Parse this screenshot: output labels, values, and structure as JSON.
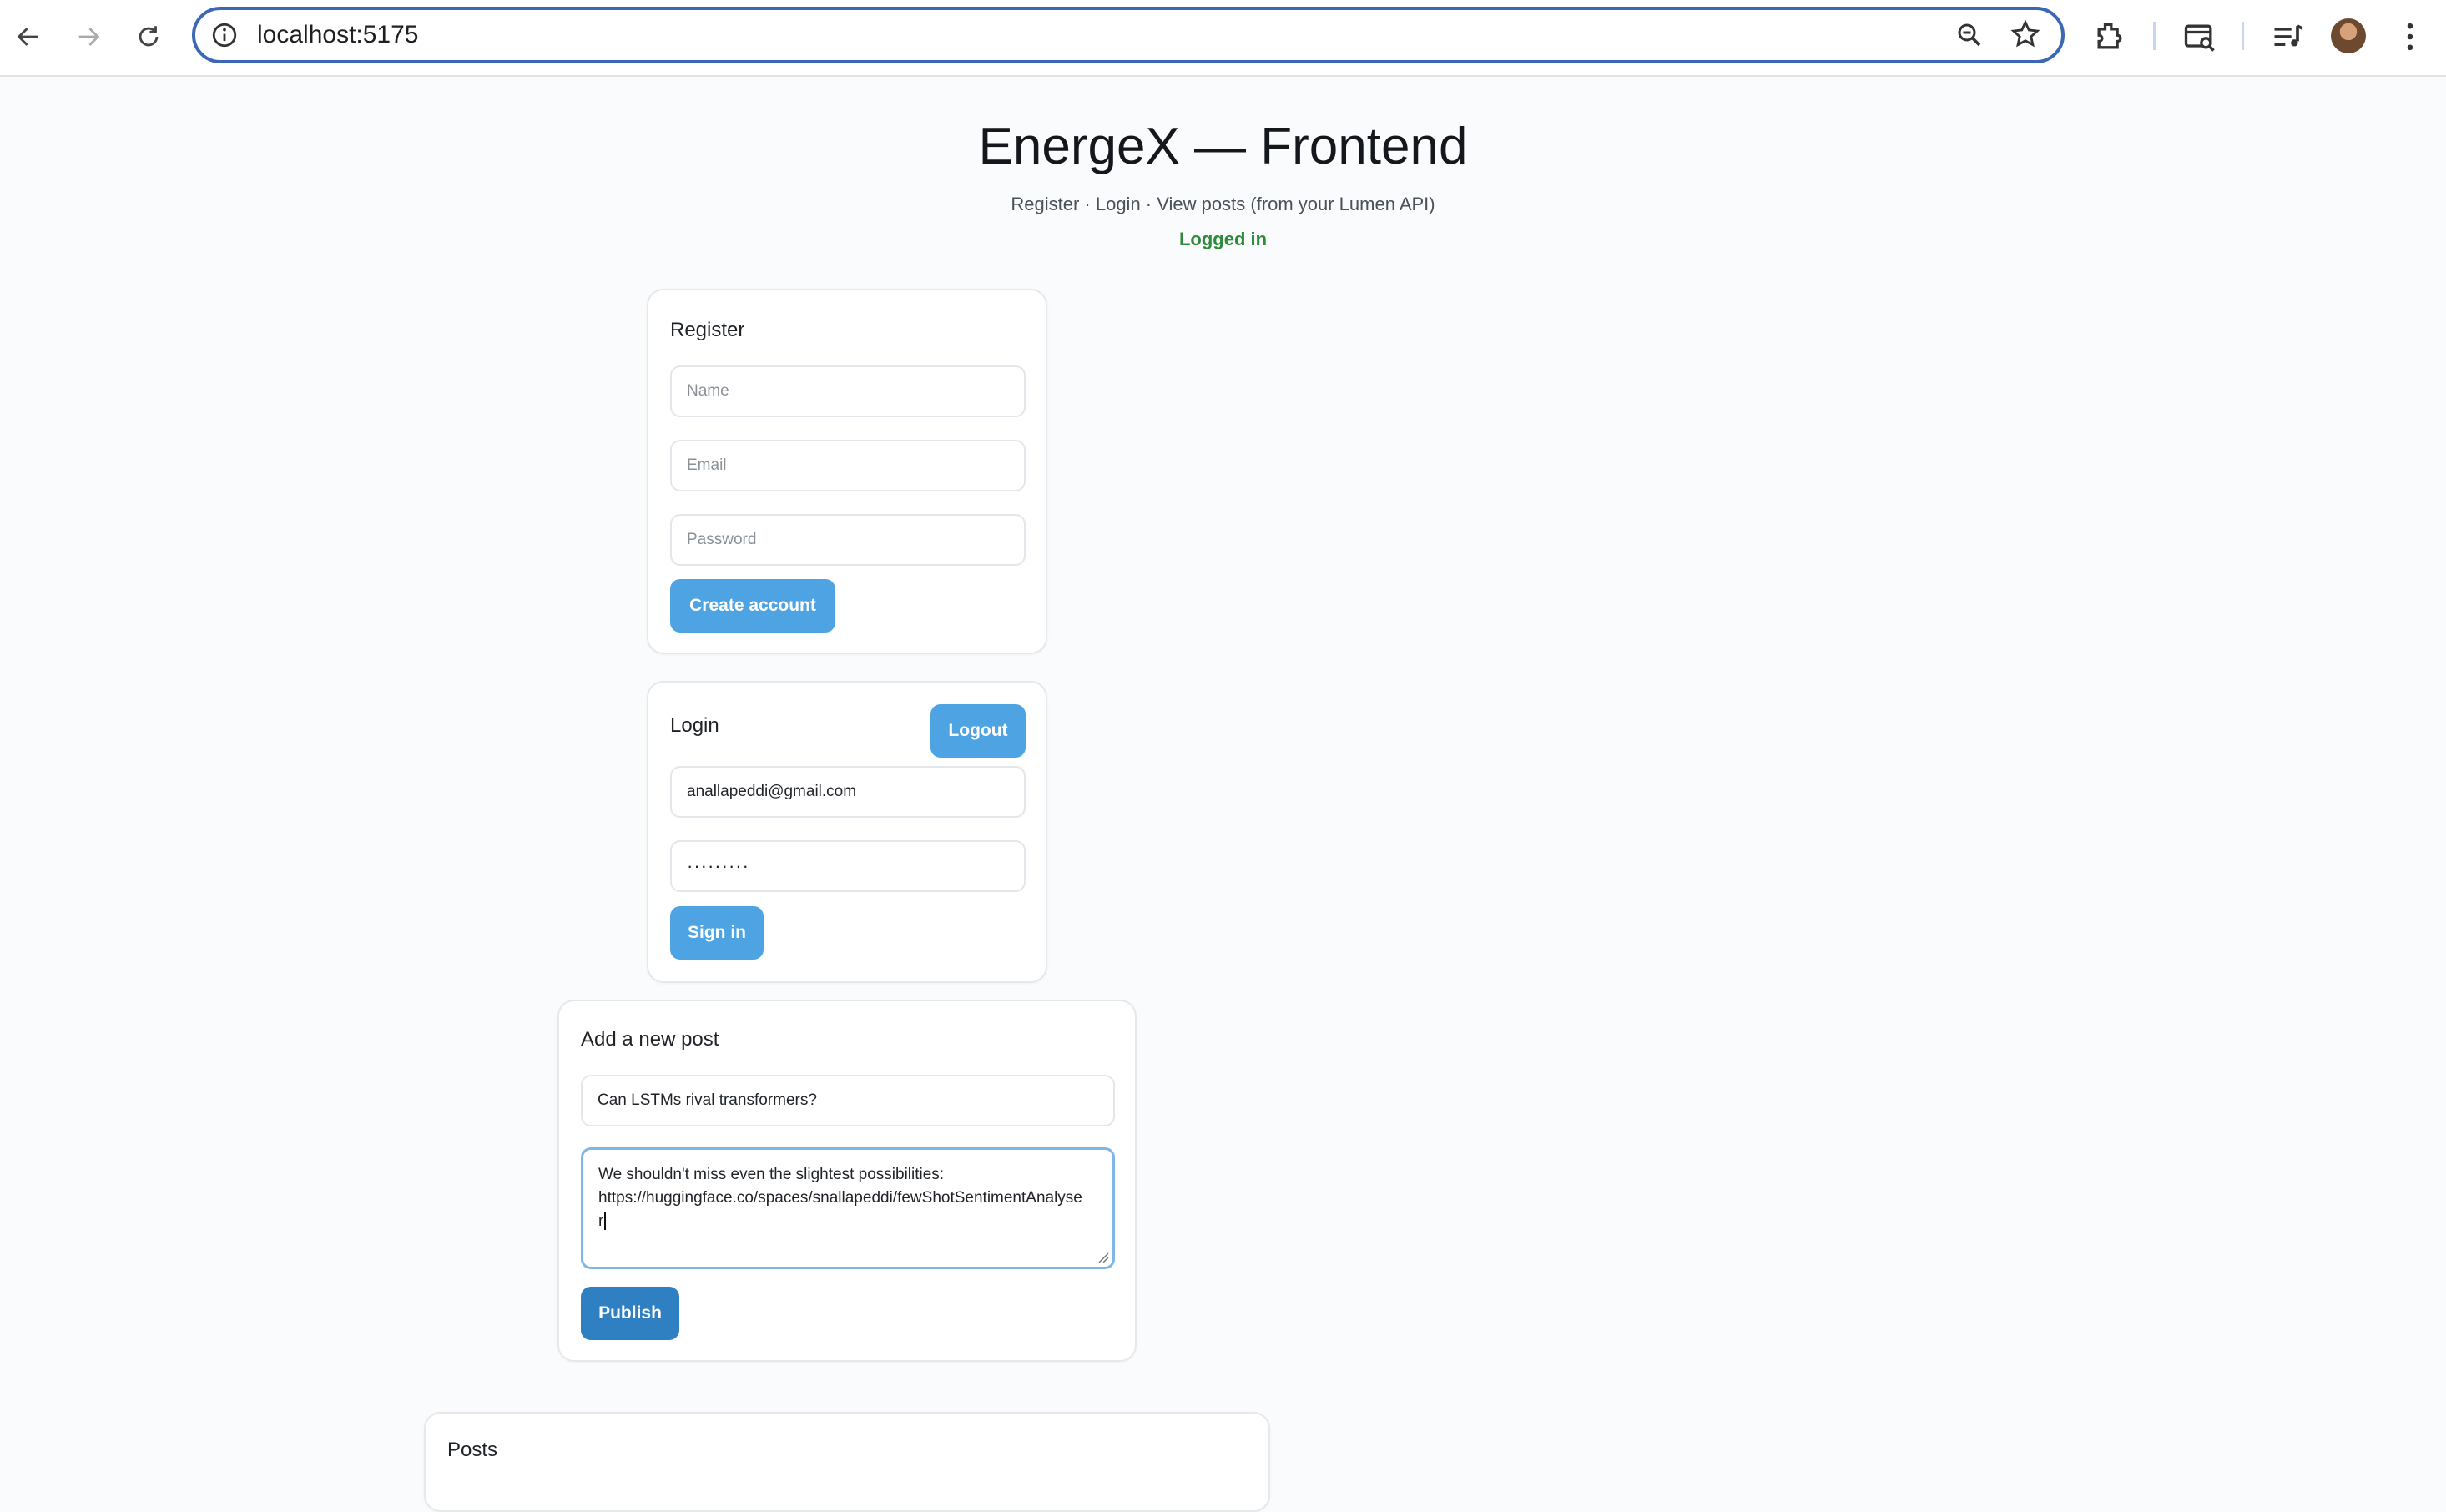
{
  "browser": {
    "url": "localhost:5175"
  },
  "page": {
    "title": "EnergeX — Frontend",
    "subtitle": "Register · Login · View posts (from your Lumen API)",
    "status": "Logged in",
    "status_color": "#2e8b3a"
  },
  "register": {
    "heading": "Register",
    "name_placeholder": "Name",
    "email_placeholder": "Email",
    "password_placeholder": "Password",
    "submit_label": "Create account"
  },
  "login": {
    "heading": "Login",
    "logout_label": "Logout",
    "email_value": "anallapeddi@gmail.com",
    "password_value": "·········",
    "submit_label": "Sign in"
  },
  "new_post": {
    "heading": "Add a new post",
    "title_value": "Can LSTMs rival transformers?",
    "body_line1": "We shouldn't miss even the slightest possibilities:",
    "body_line2": "https://huggingface.co/spaces/snallapeddi/fewShotSentimentAnalyse",
    "body_line3": "r",
    "publish_label": "Publish"
  },
  "posts": {
    "heading": "Posts"
  },
  "colors": {
    "accent_light": "#4ea3e2",
    "accent_dark": "#2f7fc3",
    "omnibox_border": "#3b67b5"
  }
}
